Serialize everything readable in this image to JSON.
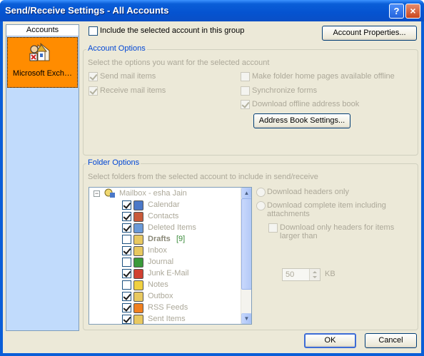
{
  "window": {
    "title": "Send/Receive Settings - All Accounts",
    "help_glyph": "?",
    "close_glyph": "×"
  },
  "accounts": {
    "header": "Accounts",
    "items": [
      {
        "label": "Microsoft Exch…",
        "selected": true
      }
    ]
  },
  "group_option": {
    "label": "Include the selected account in this group",
    "checked": false
  },
  "account_properties_button": "Account Properties...",
  "account_options": {
    "title": "Account Options",
    "description": "Select the options you want for the selected account",
    "send_mail": {
      "label": "Send mail items",
      "checked": true
    },
    "receive_mail": {
      "label": "Receive mail items",
      "checked": true
    },
    "make_folder_home": {
      "label": "Make folder home pages available offline",
      "checked": false
    },
    "sync_forms": {
      "label": "Synchronize forms",
      "checked": false
    },
    "download_oab": {
      "label": "Download offline address book",
      "checked": true
    },
    "address_book_button": "Address Book Settings..."
  },
  "folder_options": {
    "title": "Folder Options",
    "description": "Select folders from the selected account to include in send/receive",
    "mailbox": {
      "expander": "−",
      "label": "Mailbox - esha Jain"
    },
    "folders": [
      {
        "label": "Calendar",
        "checked": true,
        "icon": "calendar-icon",
        "color": "#4a78c8"
      },
      {
        "label": "Contacts",
        "checked": true,
        "icon": "contacts-icon",
        "color": "#c85a3a"
      },
      {
        "label": "Deleted Items",
        "checked": true,
        "icon": "deleted-items-icon",
        "color": "#6a9ad8"
      },
      {
        "label": "Drafts",
        "count": "[9]",
        "checked": false,
        "icon": "drafts-icon",
        "color": "#e8c860"
      },
      {
        "label": "Inbox",
        "checked": true,
        "icon": "inbox-icon",
        "color": "#e8c860"
      },
      {
        "label": "Journal",
        "checked": false,
        "icon": "journal-icon",
        "color": "#3a9a3a"
      },
      {
        "label": "Junk E-Mail",
        "checked": true,
        "icon": "junk-email-icon",
        "color": "#d04030"
      },
      {
        "label": "Notes",
        "checked": false,
        "icon": "notes-icon",
        "color": "#f0d040"
      },
      {
        "label": "Outbox",
        "checked": true,
        "icon": "outbox-icon",
        "color": "#e8c860"
      },
      {
        "label": "RSS Feeds",
        "checked": true,
        "icon": "rss-feeds-icon",
        "color": "#f08020"
      },
      {
        "label": "Sent Items",
        "checked": true,
        "icon": "sent-items-icon",
        "color": "#e8c860"
      }
    ],
    "download_headers": "Download headers only",
    "download_complete": "Download complete item including attachments",
    "download_only_headers": "Download only headers for items larger than",
    "size_value": "50",
    "size_unit": "KB"
  },
  "ok_button": "OK",
  "cancel_button": "Cancel"
}
